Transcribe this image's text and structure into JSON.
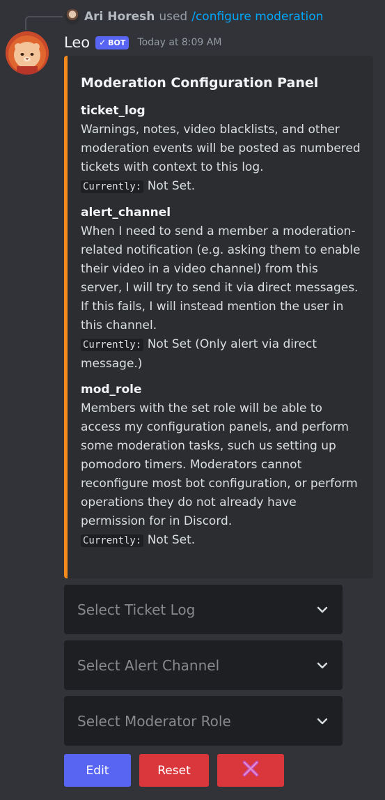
{
  "reply": {
    "user_name": "Ari Horesh",
    "action": "used",
    "command": "/configure moderation"
  },
  "message": {
    "author": "Leo",
    "badge": "BOT",
    "timestamp": "Today at 8:09 AM"
  },
  "embed": {
    "accent_color": "#f48a1e",
    "title": "Moderation Configuration Panel",
    "fields": [
      {
        "name": "ticket_log",
        "description": "Warnings, notes, video blacklists, and other moderation events will be posted as numbered tickets with context to this log.",
        "current_label": "Currently:",
        "current_value": "Not Set."
      },
      {
        "name": "alert_channel",
        "description": "When I need to send a member a moderation-related notification (e.g. asking them to enable their video in a video channel) from this server, I will try to send it via direct messages. If this fails, I will instead mention the user in this channel.",
        "current_label": "Currently:",
        "current_value": "Not Set (Only alert via direct message.)"
      },
      {
        "name": "mod_role",
        "description": "Members with the set role will be able to access my configuration panels, and perform some moderation tasks, such us setting up pomodoro timers. Moderators cannot reconfigure most bot configuration, or perform operations they do not already have permission for in Discord.",
        "current_label": "Currently:",
        "current_value": "Not Set."
      }
    ]
  },
  "selects": [
    {
      "placeholder": "Select Ticket Log",
      "icon": "chevron-down-icon"
    },
    {
      "placeholder": "Select Alert Channel",
      "icon": "chevron-down-icon"
    },
    {
      "placeholder": "Select Moderator Role",
      "icon": "chevron-down-icon"
    }
  ],
  "buttons": {
    "edit_label": "Edit",
    "reset_label": "Reset",
    "close_icon": "cross-mark-icon"
  },
  "colors": {
    "background": "#313338",
    "embed_background": "#2b2d31",
    "blurple": "#5865f2",
    "danger": "#da373c",
    "link": "#00a8fc"
  }
}
